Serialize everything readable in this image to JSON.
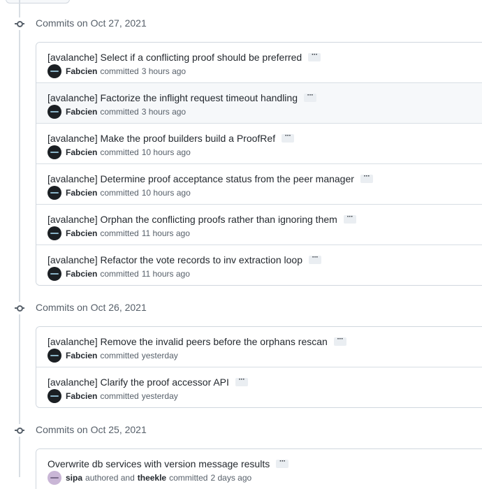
{
  "groups": [
    {
      "date_label": "Commits on Oct 27, 2021",
      "commits": [
        {
          "title": "[avalanche] Select if a conflicting proof should be preferred",
          "author": "Fabcien",
          "verb": "committed",
          "time": "3 hours ago"
        },
        {
          "title": "[avalanche] Factorize the inflight request timeout handling",
          "author": "Fabcien",
          "verb": "committed",
          "time": "3 hours ago"
        },
        {
          "title": "[avalanche] Make the proof builders build a ProofRef",
          "author": "Fabcien",
          "verb": "committed",
          "time": "10 hours ago"
        },
        {
          "title": "[avalanche] Determine proof acceptance status from the peer manager",
          "author": "Fabcien",
          "verb": "committed",
          "time": "10 hours ago"
        },
        {
          "title": "[avalanche] Orphan the conflicting proofs rather than ignoring them",
          "author": "Fabcien",
          "verb": "committed",
          "time": "11 hours ago"
        },
        {
          "title": "[avalanche] Refactor the vote records to inv extraction loop",
          "author": "Fabcien",
          "verb": "committed",
          "time": "11 hours ago"
        }
      ]
    },
    {
      "date_label": "Commits on Oct 26, 2021",
      "commits": [
        {
          "title": "[avalanche] Remove the invalid peers before the orphans rescan",
          "author": "Fabcien",
          "verb": "committed",
          "time": "yesterday"
        },
        {
          "title": "[avalanche] Clarify the proof accessor API",
          "author": "Fabcien",
          "verb": "committed",
          "time": "yesterday"
        }
      ]
    },
    {
      "date_label": "Commits on Oct 25, 2021",
      "commits": [
        {
          "title": "Overwrite db services with version message results",
          "author": "sipa",
          "verb": "authored and",
          "co_author": "theekle",
          "co_verb": "committed",
          "time": "2 days ago"
        }
      ]
    }
  ],
  "ellipsis_label": "···"
}
